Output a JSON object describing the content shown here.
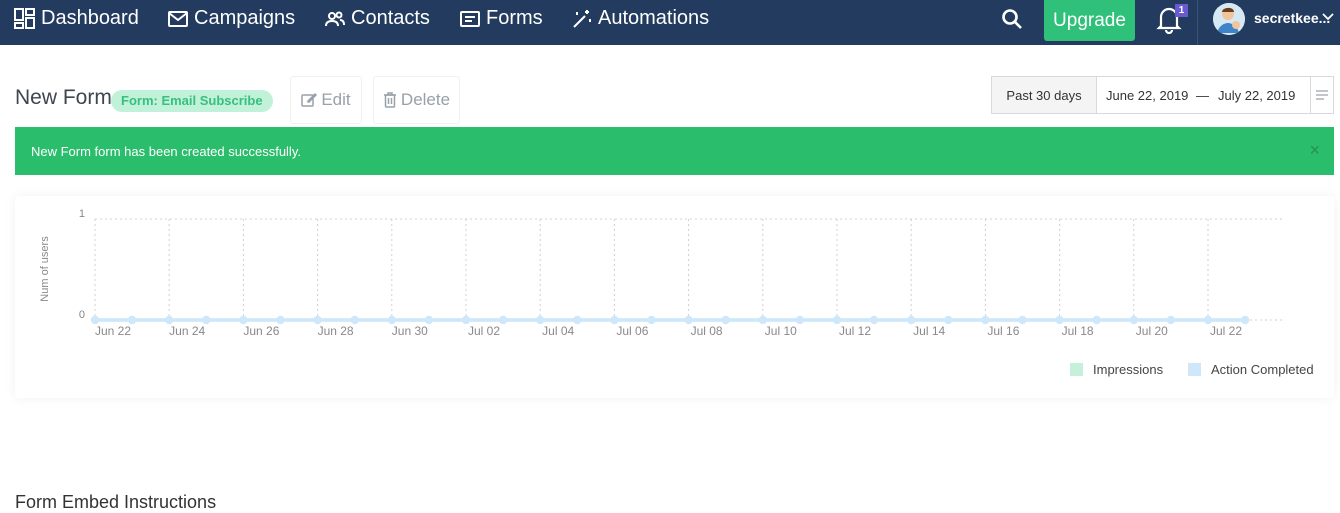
{
  "nav": {
    "items": [
      {
        "label": "Dashboard",
        "icon": "dashboard-icon"
      },
      {
        "label": "Campaigns",
        "icon": "mail-icon"
      },
      {
        "label": "Contacts",
        "icon": "contacts-icon"
      },
      {
        "label": "Forms",
        "icon": "form-icon"
      },
      {
        "label": "Automations",
        "icon": "magic-wand-icon"
      }
    ],
    "upgrade_label": "Upgrade",
    "notifications_count": "1",
    "username": "secretkee..."
  },
  "header": {
    "title": "New Form",
    "tag": "Form: Email Subscribe",
    "edit_label": "Edit",
    "delete_label": "Delete"
  },
  "date_range": {
    "preset": "Past 30 days",
    "start": "June 22, 2019",
    "separator": "—",
    "end": "July 22, 2019"
  },
  "alert": {
    "message": "New Form form has been created successfully.",
    "close": "×"
  },
  "chart_data": {
    "type": "line",
    "ylabel": "Num of users",
    "ylim": [
      0,
      1
    ],
    "yticks": [
      "0",
      "1"
    ],
    "x_tick_labels": [
      "Jun 22",
      "Jun 24",
      "Jun 26",
      "Jun 28",
      "Jun 30",
      "Jul 02",
      "Jul 04",
      "Jul 06",
      "Jul 08",
      "Jul 10",
      "Jul 12",
      "Jul 14",
      "Jul 16",
      "Jul 18",
      "Jul 20",
      "Jul 22"
    ],
    "x": [
      "Jun 22",
      "Jun 23",
      "Jun 24",
      "Jun 25",
      "Jun 26",
      "Jun 27",
      "Jun 28",
      "Jun 29",
      "Jun 30",
      "Jul 01",
      "Jul 02",
      "Jul 03",
      "Jul 04",
      "Jul 05",
      "Jul 06",
      "Jul 07",
      "Jul 08",
      "Jul 09",
      "Jul 10",
      "Jul 11",
      "Jul 12",
      "Jul 13",
      "Jul 14",
      "Jul 15",
      "Jul 16",
      "Jul 17",
      "Jul 18",
      "Jul 19",
      "Jul 20",
      "Jul 21",
      "Jul 22",
      "Jul 23"
    ],
    "series": [
      {
        "name": "Impressions",
        "color": "#c5f1da",
        "values": [
          0,
          0,
          0,
          0,
          0,
          0,
          0,
          0,
          0,
          0,
          0,
          0,
          0,
          0,
          0,
          0,
          0,
          0,
          0,
          0,
          0,
          0,
          0,
          0,
          0,
          0,
          0,
          0,
          0,
          0,
          0,
          0
        ]
      },
      {
        "name": "Action Completed",
        "color": "#cfe7fb",
        "values": [
          0,
          0,
          0,
          0,
          0,
          0,
          0,
          0,
          0,
          0,
          0,
          0,
          0,
          0,
          0,
          0,
          0,
          0,
          0,
          0,
          0,
          0,
          0,
          0,
          0,
          0,
          0,
          0,
          0,
          0,
          0,
          0
        ]
      }
    ],
    "grid": true,
    "legend": "bottom-right"
  },
  "bottom": {
    "heading": "Form Embed Instructions"
  }
}
